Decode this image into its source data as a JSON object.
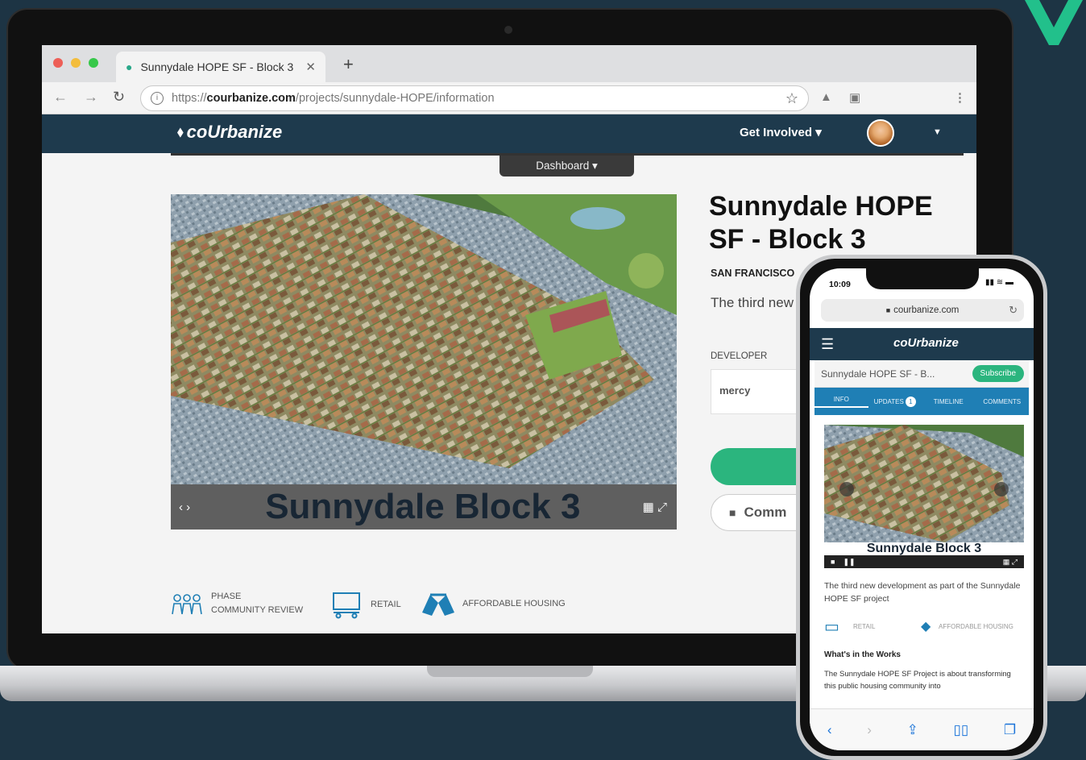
{
  "colors": {
    "background": "#1d3444",
    "nav_dark": "#1e3a4d",
    "accent_green": "#2bb57e",
    "tab_blue": "#1f7fb5",
    "icon_blue": "#1f7fb5"
  },
  "browser": {
    "tab_title": "Sunnydale HOPE SF - Block 3",
    "tab_favicon": "coUrbanize-pin-icon",
    "url_scheme": "https://",
    "url_host": "courbanize.com",
    "url_path": "/projects/sunnydale-HOPE/information"
  },
  "site": {
    "logo_text": "coUrbanize",
    "nav_get_involved": "Get Involved ▾",
    "dashboard_label": "Dashboard ▾"
  },
  "project": {
    "title": "Sunnydale HOPE SF - Block 3",
    "location": "SAN FRANCISCO",
    "description_preview": "The third new the Sunnydal",
    "developer_label": "DEVELOPER",
    "developer_logo_text": "mercy",
    "comment_button": "Comm",
    "image_caption": "Sunnydale Block 3",
    "tags": [
      {
        "icon": "people-icon",
        "line1": "PHASE",
        "line2": "COMMUNITY REVIEW"
      },
      {
        "icon": "retail-icon",
        "line1": "RETAIL",
        "line2": ""
      },
      {
        "icon": "handshake-icon",
        "line1": "AFFORDABLE HOUSING",
        "line2": ""
      }
    ]
  },
  "phone": {
    "time": "10:09",
    "address": "courbanize.com",
    "logo_text": "coUrbanize",
    "page_title": "Sunnydale HOPE SF - B...",
    "subscribe": "Subscribe",
    "tabs": [
      "INFO",
      "UPDATES",
      "TIMELINE",
      "COMMENTS"
    ],
    "updates_badge": "1",
    "image_caption": "Sunnydale Block 3",
    "description": "The third new development as part of the Sunnydale HOPE SF project",
    "tag_retail": "RETAIL",
    "tag_affordable": "AFFORDABLE HOUSING",
    "section_heading": "What's in the Works",
    "section_text": "The Sunnydale HOPE SF Project is about transforming this public housing community into"
  }
}
